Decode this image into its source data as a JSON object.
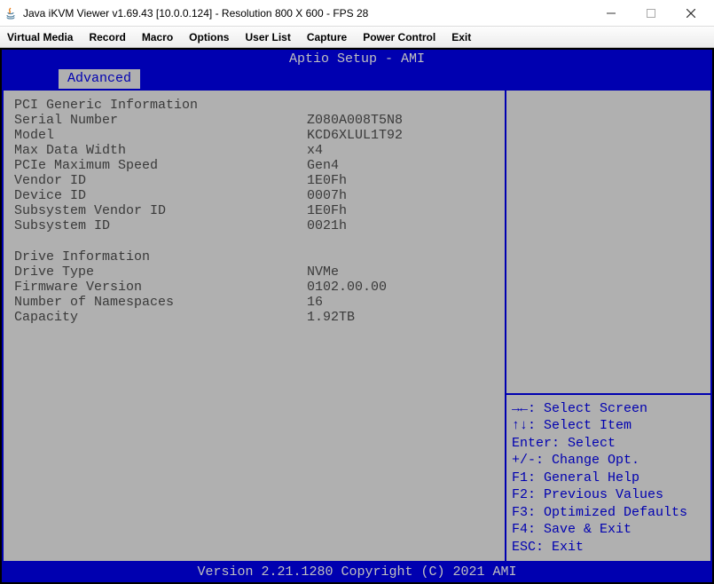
{
  "window": {
    "title": "Java iKVM Viewer v1.69.43 [10.0.0.124]  - Resolution 800 X 600 - FPS 28"
  },
  "menubar": {
    "items": [
      "Virtual Media",
      "Record",
      "Macro",
      "Options",
      "User List",
      "Capture",
      "Power Control",
      "Exit"
    ]
  },
  "bios": {
    "header": "Aptio Setup - AMI",
    "tab": "Advanced",
    "footer": "Version 2.21.1280 Copyright (C) 2021 AMI",
    "pci_section": {
      "title": "PCI Generic Information",
      "rows": [
        {
          "label": "Serial Number",
          "value": "Z080A008T5N8"
        },
        {
          "label": "Model",
          "value": "KCD6XLUL1T92"
        },
        {
          "label": "Max Data Width",
          "value": "x4"
        },
        {
          "label": "PCIe Maximum Speed",
          "value": "Gen4"
        },
        {
          "label": "Vendor ID",
          "value": "1E0Fh"
        },
        {
          "label": "Device ID",
          "value": "0007h"
        },
        {
          "label": "Subsystem Vendor ID",
          "value": "1E0Fh"
        },
        {
          "label": "Subsystem ID",
          "value": "0021h"
        }
      ]
    },
    "drive_section": {
      "title": "Drive Information",
      "rows": [
        {
          "label": "Drive Type",
          "value": "NVMe"
        },
        {
          "label": "Firmware Version",
          "value": "0102.00.00"
        },
        {
          "label": "Number of Namespaces",
          "value": "16"
        },
        {
          "label": "Capacity",
          "value": "1.92TB"
        }
      ]
    },
    "help": {
      "lines": [
        "→←: Select Screen",
        "↑↓: Select Item",
        "Enter: Select",
        "+/-: Change Opt.",
        "F1: General Help",
        "F2: Previous Values",
        "F3: Optimized Defaults",
        "F4: Save & Exit",
        "ESC: Exit"
      ]
    }
  }
}
